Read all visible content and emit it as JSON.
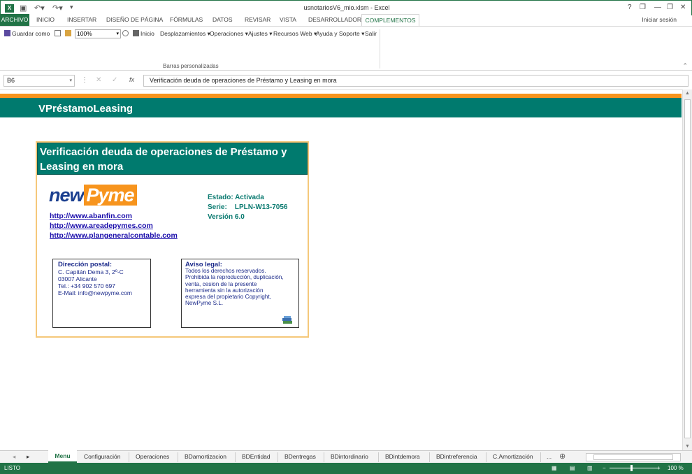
{
  "window": {
    "title": "usnotariosV6_mio.xlsm - Excel",
    "app_icon_letter": "X",
    "controls": [
      "?",
      "❐",
      "—",
      "❐",
      "✕"
    ]
  },
  "ribbon_tabs": {
    "file": "ARCHIVO",
    "items": [
      "INICIO",
      "INSERTAR",
      "DISEÑO DE PÁGINA",
      "FÓRMULAS",
      "DATOS",
      "REVISAR",
      "VISTA",
      "DESARROLLADOR"
    ],
    "active": "COMPLEMENTOS",
    "sign_in": "Iniciar sesión"
  },
  "ribbon": {
    "save_as": "Guardar como",
    "zoom": "100%",
    "home": "Inicio",
    "menus": [
      "Desplazamientos",
      "Operaciones",
      "Ajustes",
      "Recursos Web",
      "Ayuda y Soporte"
    ],
    "exit": "Salir",
    "group_label": "Barras personalizadas"
  },
  "formula_bar": {
    "name_box": "B6",
    "fx": "fx",
    "content": "Verificación deuda de operaciones de Préstamo y Leasing en mora"
  },
  "sheet": {
    "banner_title": "VPréstamoLeasing",
    "card_title": "Verificación deuda de operaciones de Préstamo y Leasing en mora",
    "logo_new": "new",
    "logo_pyme": "Pyme",
    "links": [
      "http://www.abanfin.com",
      "http://www.areadepymes.com",
      "http://www.plangeneralcontable.com"
    ],
    "status": {
      "estado": "Estado: Activada",
      "serie": "Serie:    LPLN-W13-7056",
      "version": "Versión 6.0"
    },
    "address": {
      "heading": "Dirección postal:",
      "lines": [
        "C. Capitán Dema 3, 2º-C",
        "03007 Alicante",
        "Tel.: +34 902 570 697",
        "E-Mail: info@newpyme.com"
      ]
    },
    "legal": {
      "heading": "Aviso legal:",
      "lines": [
        "Todos los derechos reservados.",
        "Prohibida la reproducción, duplicación,",
        "venta, cesion de la presente",
        "herramienta sin la autorización",
        "expresa del propietario Copyright,",
        "NewPyme S.L."
      ]
    }
  },
  "sheet_tabs": {
    "active": "Menu",
    "items": [
      "Configuración",
      "Operaciones",
      "BDamortizacion",
      "BDEntidad",
      "BDentregas",
      "BDintordinario",
      "BDintdemora",
      "BDintreferencia",
      "C.Amortización"
    ],
    "more": "...",
    "add": "⊕"
  },
  "status_bar": {
    "mode": "LISTO",
    "zoom": "100 %"
  }
}
